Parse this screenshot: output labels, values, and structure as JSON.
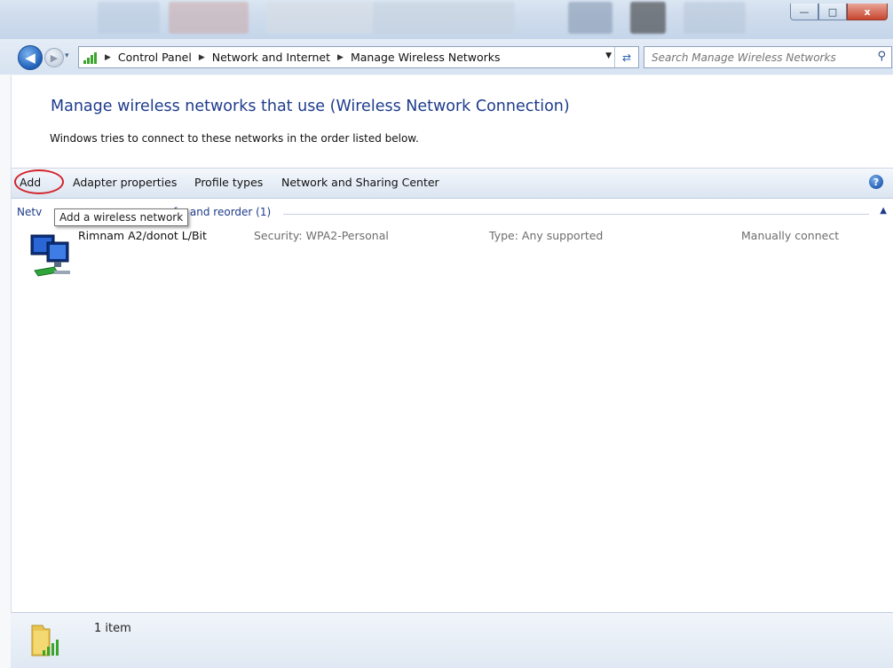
{
  "window": {
    "controls": {
      "minimize": "—",
      "maximize": "□",
      "close": "x"
    }
  },
  "nav": {
    "breadcrumb": [
      "Control Panel",
      "Network and Internet",
      "Manage Wireless Networks"
    ],
    "search_placeholder": "Search Manage Wireless Networks"
  },
  "page": {
    "heading": "Manage wireless networks that use (Wireless Network Connection)",
    "subheading": "Windows tries to connect to these networks in the order listed below."
  },
  "toolbar": {
    "add": "Add",
    "adapter": "Adapter properties",
    "profile": "Profile types",
    "sharing": "Network and Sharing Center",
    "help": "?"
  },
  "group": {
    "prefix": "Netv",
    "suffix": "fy, and reorder (1)"
  },
  "tooltip": "Add a wireless network",
  "networks": [
    {
      "name": "Rimnam A2/donot L/Bit",
      "security": "Security: WPA2-Personal",
      "type": "Type: Any supported",
      "mode": "Manually connect"
    }
  ],
  "status": {
    "text": "1 item"
  },
  "colors": {
    "accent_red": "#d2232a",
    "heading_blue": "#1e3c8c",
    "signal_green": "#3aa52c"
  }
}
